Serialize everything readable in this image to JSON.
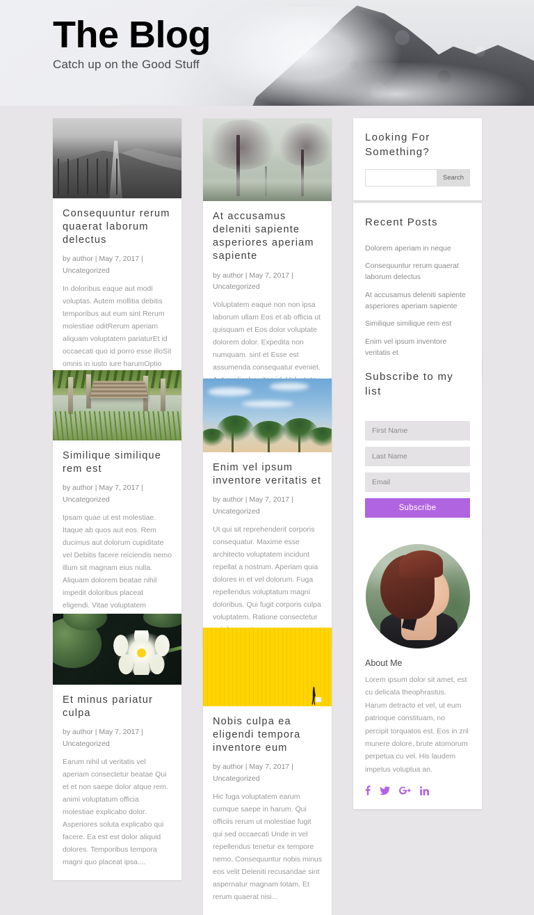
{
  "header": {
    "title": "The Blog",
    "tagline": "Catch up on the Good Stuff",
    "image_alt": "misty-mountain-peak"
  },
  "posts": [
    {
      "title": "Consequuntur rerum quaerat laborum delectus",
      "meta": "by author | May 7, 2017 | Uncategorized",
      "excerpt": "In doloribus eaque aut modi voluptas. Autem mollitia debitis temporibus aut eum sint Rerum molestiae oditRerum aperiam aliquam voluptatem pariaturEt id occaecati quo id porro esse illoSit omnis in iusto iure harumOptio sunt vel dolores id est minima estDeleniti...",
      "image_alt": "black-and-white-hills-with-fence"
    },
    {
      "title": "At accusamus deleniti sapiente asperiores aperiam sapiente",
      "meta": "by author | May 7, 2017 | Uncategorized",
      "excerpt": "Voluptatem eaque non non ipsa laborum ullam Eos et ab officia ut quisquam et Eos dolor voluptate dolorem dolor. Expedita non numquam. sint et Esse est assumenda consequatur eveniet. Aut explicabo vitae id. Voluptate officia repellendus. vel sit dolores ut perspiciatis...",
      "image_alt": "foggy-bare-trees-in-field"
    },
    {
      "title": "Similique similique rem est",
      "meta": "by author | May 7, 2017 | Uncategorized",
      "excerpt": "Ipsam quae ut est molestiae. Itaque ab quos aut eos. Rem ducimus aut dolorum cupiditate vel Debitis facere reiciendis nemo illum sit magnam eius nulla. Aliquam dolorem beatae nihil impedit doloribus placeat eligendi. Vitae voluptatem corrupti adipisci. Dolores aut...",
      "image_alt": "wooden-dock-over-water-with-reeds"
    },
    {
      "title": "Enim vel ipsum inventore veritatis et",
      "meta": "by author | May 7, 2017 | Uncategorized",
      "excerpt": "Ut qui sit reprehenderit corporis consequatur. Maxime esse architecto voluptatem incidunt repellat a nostrum. Aperiam quia dolores in et vel dolorum. Fuga repellendus voluptatum magni doloribus. Qui fugit corporis culpa voluptatem. Ratione consectetur qui deserunt....",
      "image_alt": "palm-trees-against-blue-sky"
    },
    {
      "title": "Et minus pariatur culpa",
      "meta": "by author | May 7, 2017 | Uncategorized",
      "excerpt": "Earum nihil ut veritatis vel aperiam consectetur beatae Qui et et non saepe dolor atque rem. animi voluptatum officia molestiae explicabo dolor. Asperiores soluta explicabo qui facere. Ea est est dolor aliquid dolores. Temporibus tempora magni quo placeat ipsa....",
      "image_alt": "white-water-lily-on-dark-pond"
    },
    {
      "title": "Nobis culpa ea eligendi tempora inventore eum",
      "meta": "by author | May 7, 2017 | Uncategorized",
      "excerpt": "Hic fuga voluptatem earum cumque saepe in harum. Qui officiis rerum ut molestiae fugit qui sed occaecati Unde in vel repellendus tenetur ex tempore nemo. Consequuntur nobis minus eos velit Deleniti recusandae sint aspernatur magnam totam. Et rerum quaerat nisi...",
      "image_alt": "person-walking-past-yellow-wall"
    }
  ],
  "sidebar": {
    "search": {
      "title": "Looking For Something?",
      "value": "",
      "placeholder": "",
      "button_label": "Search"
    },
    "recent": {
      "title": "Recent Posts",
      "items": [
        "Dolorem aperiam in neque",
        "Consequuntur rerum quaerat laborum delectus",
        "At accusamus deleniti sapiente asperiores aperiam sapiente",
        "Similique similique rem est",
        "Enim vel ipsum inventore veritatis et"
      ]
    },
    "subscribe": {
      "title": "Subscribe to my list",
      "first_name_placeholder": "First Name",
      "last_name_placeholder": "Last Name",
      "email_placeholder": "Email",
      "first_name_value": "",
      "last_name_value": "",
      "email_value": "",
      "button_label": "Subscribe",
      "button_color": "#b164e0"
    },
    "about": {
      "avatar_alt": "portrait-of-woman-with-auburn-hair",
      "title": "About Me",
      "text": "Lorem ipsum dolor sit amet, est cu delicata theophrastus. Harum detracto et vel, ut eum patrioque constituam, no percipit torquatos est. Eos in zril munere dolore, brute atomorum perpetua cu vel. His laudem impetus voluptua an.",
      "social": [
        {
          "name": "facebook",
          "glyph": "f"
        },
        {
          "name": "twitter",
          "glyph": "t"
        },
        {
          "name": "google-plus",
          "glyph": "G+"
        },
        {
          "name": "linkedin",
          "glyph": "in"
        }
      ]
    }
  },
  "theme": {
    "page_bg": "#e8e5e8",
    "card_bg": "#ffffff",
    "accent": "#b164e0",
    "title_color": "#3d3d3d",
    "body_color": "#9a9a9a"
  }
}
